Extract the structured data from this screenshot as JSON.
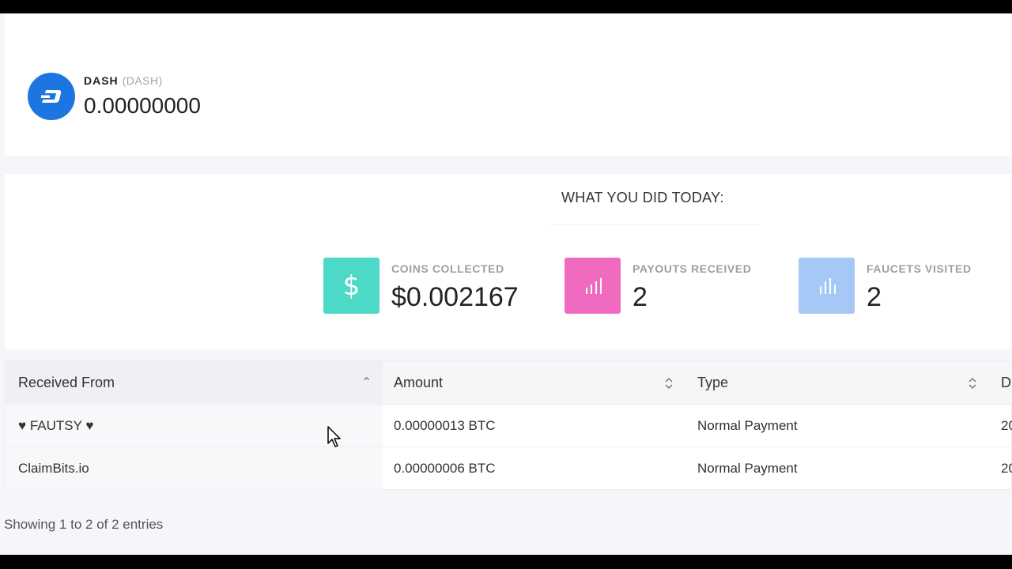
{
  "dash_card": {
    "coin_name": "DASH",
    "coin_symbol": "(DASH)",
    "balance": "0.00000000",
    "icon": "dash-logo-icon",
    "color": "#1c75e0"
  },
  "today": {
    "title": "WHAT YOU DID TODAY:",
    "stats": [
      {
        "label": "COINS COLLECTED",
        "value": "$0.002167",
        "icon": "dollar-icon",
        "color": "#4dd9c8"
      },
      {
        "label": "PAYOUTS RECEIVED",
        "value": "2",
        "icon": "bar-chart-icon",
        "color": "#f06bbf"
      },
      {
        "label": "FAUCETS VISITED",
        "value": "2",
        "icon": "bar-chart-icon",
        "color": "#a6c8f7"
      }
    ]
  },
  "table": {
    "columns": [
      "Received From",
      "Amount",
      "Type",
      "D"
    ],
    "rows": [
      {
        "from": "♥ FAUTSY ♥",
        "amount": "0.00000013 BTC",
        "type": "Normal Payment",
        "date": "20"
      },
      {
        "from": "ClaimBits.io",
        "amount": "0.00000006 BTC",
        "type": "Normal Payment",
        "date": "20"
      }
    ],
    "info": "Showing 1 to 2 of 2 entries"
  }
}
